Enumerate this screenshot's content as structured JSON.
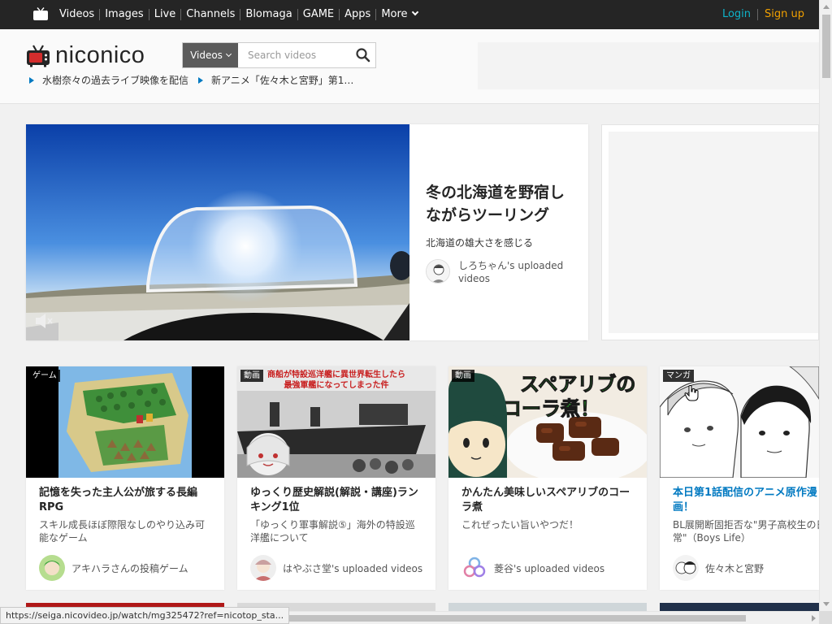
{
  "topbar": {
    "nav": [
      "Videos",
      "Images",
      "Live",
      "Channels",
      "Blomaga",
      "GAME",
      "Apps",
      "More"
    ],
    "login": "Login",
    "signup": "Sign up",
    "partial_right": "("
  },
  "header": {
    "logo_text": "niconico",
    "search_category": "Videos",
    "search_placeholder": "Search videos",
    "ticker": [
      "水樹奈々の過去ライブ映像を配信",
      "新アニメ「佐々木と宮野」第1…"
    ]
  },
  "feature": {
    "title": "冬の北海道を野宿しながらツーリング",
    "description": "北海道の雄大さを感じる",
    "user": "しろちゃん's uploaded videos"
  },
  "cards": [
    {
      "badge": "ゲーム",
      "title": "記憶を失った主人公が旅する長編RPG",
      "description": "スキル成長ほぼ際限なしのやり込み可能なゲーム",
      "user": "アキハラさんの投稿ゲーム"
    },
    {
      "badge": "動画",
      "title": "ゆっくり歴史解説(解説・講座)ランキング1位",
      "description": "「ゆっくり軍事解説⑤」海外の特設巡洋艦について",
      "user": "はやぶさ堂's uploaded videos",
      "thumb_text": "商船が特設巡洋艦に異世界転生したら最強軍艦になってしまった件"
    },
    {
      "badge": "動画",
      "title": "かんたん美味しいスペアリブのコーラ煮",
      "description": "これぜったい旨いやつだ！",
      "user": "菱谷's uploaded videos",
      "thumb_text": "スペアリブのコーラ煮！"
    },
    {
      "badge": "マンガ",
      "title": "本日第1話配信のアニメ原作漫画！",
      "description": "BL展開断固拒否な\"男子高校生の日常\"（Boys Life）",
      "user": "佐々木と宮野"
    }
  ],
  "status_url": "https://seiga.nicovideo.jp/watch/mg325472?ref=nicotop_sta...",
  "colors": {
    "topbar_bg": "#252525",
    "login": "#0eb4c9",
    "signup": "#f2a100",
    "link_blue": "#0079c1"
  }
}
